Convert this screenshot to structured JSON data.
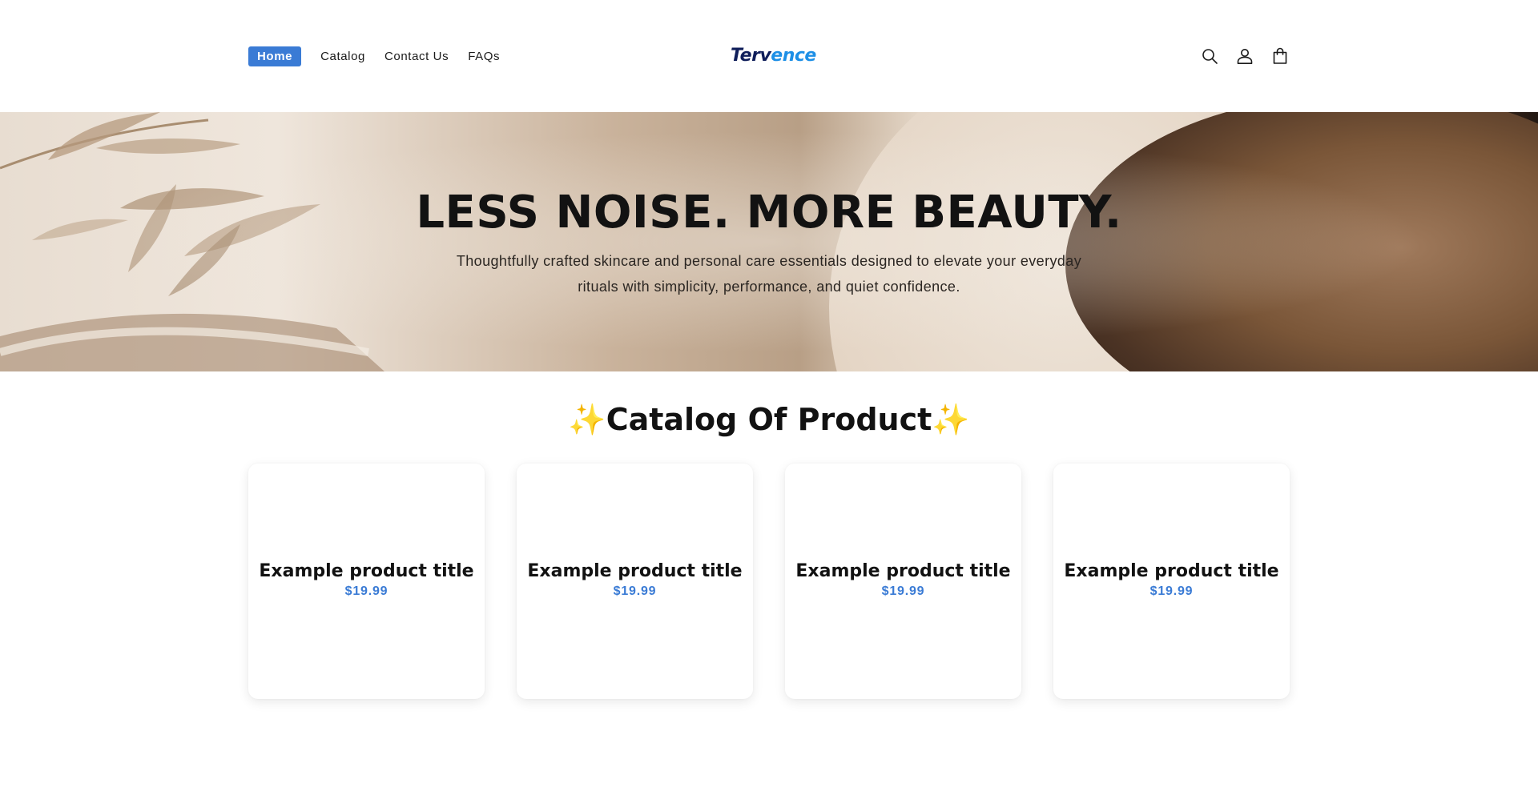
{
  "header": {
    "nav": [
      {
        "label": "Home",
        "active": true
      },
      {
        "label": "Catalog",
        "active": false
      },
      {
        "label": "Contact Us",
        "active": false
      },
      {
        "label": "FAQs",
        "active": false
      }
    ],
    "logo": {
      "part1": "Terv",
      "part2": "ence"
    },
    "icons": [
      "search-icon",
      "account-icon",
      "cart-icon"
    ],
    "accent_color": "#3a7bd5"
  },
  "hero": {
    "title": "LESS NOISE. MORE BEAUTY.",
    "subtitle": "Thoughtfully crafted skincare and personal care essentials designed to elevate your everyday rituals with simplicity, performance, and quiet confidence."
  },
  "catalog": {
    "spark_left": "✨",
    "title": "Catalog Of Product",
    "spark_right": "✨",
    "products": [
      {
        "title": "Example product title",
        "price": "$19.99"
      },
      {
        "title": "Example product title",
        "price": "$19.99"
      },
      {
        "title": "Example product title",
        "price": "$19.99"
      },
      {
        "title": "Example product title",
        "price": "$19.99"
      }
    ]
  }
}
